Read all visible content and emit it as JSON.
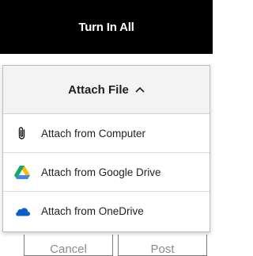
{
  "turn_in_all": {
    "label": "Turn In All"
  },
  "attach_menu": {
    "header_label": "Attach File",
    "items": [
      {
        "label": "Attach from Computer",
        "icon": "paperclip-icon"
      },
      {
        "label": "Attach from Google Drive",
        "icon": "google-drive-icon"
      },
      {
        "label": "Attach from OneDrive",
        "icon": "onedrive-icon"
      }
    ]
  },
  "footer_buttons": {
    "cancel_label": "Cancel",
    "post_label": "Post"
  },
  "colors": {
    "turn_in_bg": "#000000",
    "header_bg": "#f3f3f3",
    "onedrive": "#0a5fc8"
  }
}
